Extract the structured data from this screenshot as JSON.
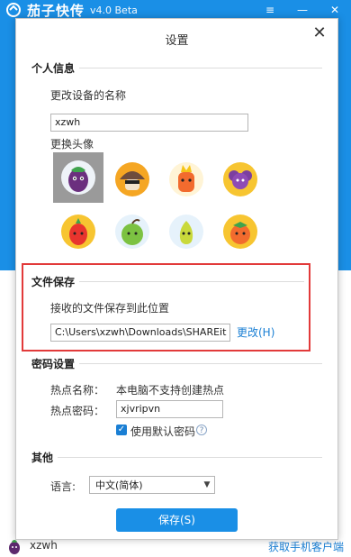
{
  "app": {
    "title": "茄子快传",
    "version": "v4.0 Beta",
    "user_name": "xzwh",
    "client_link": "获取手机客户端",
    "win_buttons": {
      "menu": "≡",
      "minimize": "—",
      "close": "✕"
    }
  },
  "dialog": {
    "title": "设置",
    "close": "✕",
    "personal": {
      "heading": "个人信息",
      "device_name_label": "更改设备的名称",
      "device_name_value": "xzwh",
      "avatar_label": "更换头像",
      "avatars": [
        "eggplant",
        "mushroom",
        "carrot",
        "grape",
        "pepper",
        "apple",
        "pear",
        "tomato"
      ],
      "selected_avatar": "eggplant"
    },
    "file_save": {
      "heading": "文件保存",
      "location_label": "接收的文件保存到此位置",
      "path_value": "C:\\Users\\xzwh\\Downloads\\SHAREit",
      "change_link": "更改(H)"
    },
    "password": {
      "heading": "密码设置",
      "hotspot_name_label": "热点名称：",
      "hotspot_name_value": "本电脑不支持创建热点",
      "hotspot_pwd_label": "热点密码：",
      "hotspot_pwd_value": "xjvripvn",
      "default_pwd_label": "使用默认密码",
      "default_pwd_checked": true
    },
    "other": {
      "heading": "其他",
      "language_label": "语言:",
      "language_value": "中文(简体)"
    },
    "save_button": "保存(S)"
  },
  "colors": {
    "brand_blue": "#1a8fe6",
    "link_blue": "#1a7fd4",
    "highlight_red": "#e23a3a"
  }
}
